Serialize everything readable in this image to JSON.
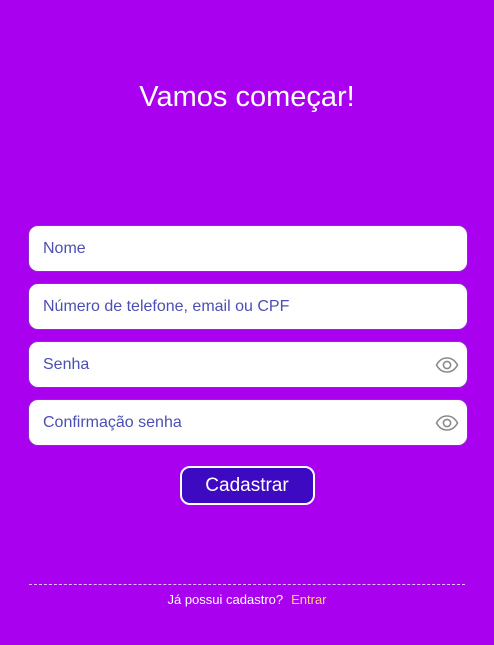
{
  "page": {
    "title": "Vamos começar!"
  },
  "form": {
    "name_placeholder": "Nome",
    "contact_placeholder": "Número de telefone, email ou CPF",
    "password_placeholder": "Senha",
    "confirm_placeholder": "Confirmação senha",
    "password_toggle_icon": "eye-icon",
    "confirm_toggle_icon": "eye-icon",
    "submit_label": "Cadastrar"
  },
  "footer": {
    "question": "Já possui cadastro?",
    "login_link": "Entrar"
  },
  "colors": {
    "background": "#aa00f0",
    "button": "#3d0ac2",
    "link": "#ffd27a",
    "placeholder": "#4b4fb3"
  }
}
